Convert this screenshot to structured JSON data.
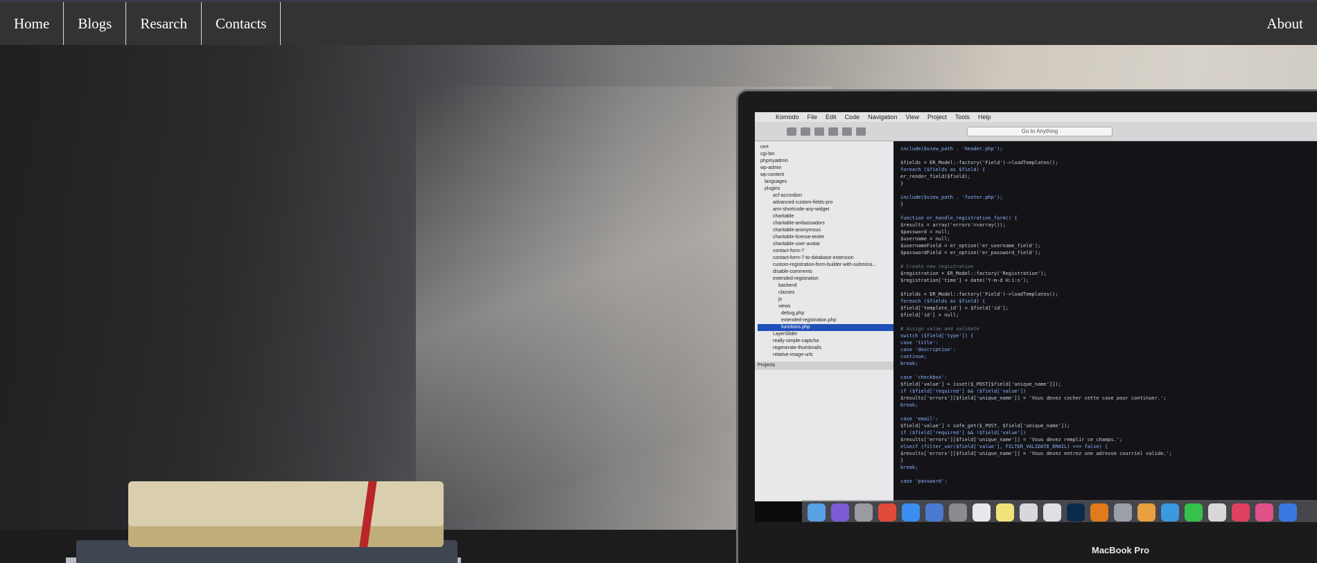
{
  "nav": {
    "left": [
      {
        "label": "Home"
      },
      {
        "label": "Blogs"
      },
      {
        "label": "Resarch"
      },
      {
        "label": "Contacts"
      }
    ],
    "right": {
      "label": "About"
    }
  },
  "hero": {
    "ide": {
      "menu": [
        "Komodo",
        "File",
        "Edit",
        "Code",
        "Navigation",
        "View",
        "Project",
        "Tools",
        "Help"
      ],
      "goto_placeholder": "Go to Anything",
      "sidebar_items": [
        "cert",
        "cgi-bin",
        "phpmyadmin",
        "wp-admin",
        "wp-content",
        "languages",
        "plugins",
        "acf-accordion",
        "advanced-custom-fields-pro",
        "amr-shortcode-any-widget",
        "charitable",
        "charitable-ambassadors",
        "charitable-anonymous",
        "charitable-license-tester",
        "charitable-user-avatar",
        "contact-form-7",
        "contact-form-7-to-database-extension",
        "custom-registration-form-builder-with-submissi...",
        "disable-comments",
        "extended-registration",
        "backend",
        "classes",
        "js",
        "views",
        "debug.php",
        "extended-registration.php",
        "functions.php",
        "LayerSlider",
        "really-simple-captcha",
        "regenerate-thumbnails",
        "relative-image-urls"
      ],
      "selected_item": "functions.php",
      "projects_label": "Projects",
      "code": [
        "include($view_path . 'header.php');",
        "",
        "$fields = ER_Model::factory('Field')->loadTemplates();",
        "foreach ($fields as $field) {",
        "    er_render_field($field);",
        "}",
        "",
        "include($view_path . 'footer.php');",
        "}",
        "",
        "function er_handle_registration_form() {",
        "  $results = array('errors'=>array());",
        "  $password = null;",
        "  $username = null;",
        "  $usernameField = er_option('er_username_field');",
        "  $passwordField = er_option('er_password_field');",
        "",
        "  # Create new registration",
        "  $registration = ER_Model::factory('Registration');",
        "  $registration['time'] = date('Y-m-d H:i:s');",
        "",
        "  $fields = ER_Model::factory('Field')->loadTemplates();",
        "  foreach ($fields as $field) {",
        "    $field['template_id'] = $field['id'];",
        "    $field['id'] = null;",
        "",
        "    # Assign value and validate",
        "    switch ($field['type']) {",
        "      case 'title':",
        "      case 'description':",
        "        continue;",
        "        break;",
        "",
        "      case 'checkbox':",
        "        $field['value'] = isset($_POST[$field['unique_name']]);",
        "        if ($field['required'] && !$field['value'])",
        "          $results['errors'][$field['unique_name']] = 'Vous devez cocher cette case pour continuer.';",
        "        break;",
        "",
        "      case 'email':",
        "        $field['value'] = safe_get($_POST, $field['unique_name']);",
        "        if ($field['required'] && !$field['value'])",
        "          $results['errors'][$field['unique_name']] = 'Vous devez remplir ce champs.';",
        "        elseif (filter_var($field['value'], FILTER_VALIDATE_EMAIL) === false) {",
        "          $results['errors'][$field['unique_name']] = 'Vous devez entrez une adresse courriel valide.';",
        "        }",
        "        break;",
        "",
        "      case 'password':"
      ]
    },
    "laptop_label": "MacBook Pro",
    "dock_colors": [
      "#5aa0e6",
      "#7b5cd6",
      "#9a9aa0",
      "#e24a3b",
      "#3b8df0",
      "#4a7bd0",
      "#8a8a90",
      "#e8e8ea",
      "#f2e27a",
      "#d8d8dc",
      "#e0e0e4",
      "#0a2a4a",
      "#e07a1a",
      "#9aa0aa",
      "#e8a040",
      "#3a9ae0",
      "#35c24a",
      "#d8d8d8",
      "#e04060",
      "#e0508a",
      "#3a7ae0"
    ]
  }
}
